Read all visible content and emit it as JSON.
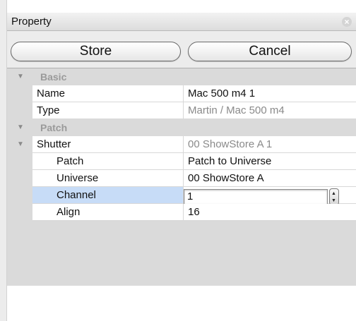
{
  "window": {
    "title": "Property"
  },
  "buttons": {
    "store_label": "Store",
    "cancel_label": "Cancel"
  },
  "sections": {
    "basic": {
      "label": "Basic",
      "rows": [
        {
          "name": "Name",
          "value": "Mac 500 m4 1"
        },
        {
          "name": "Type",
          "value": "Martin / Mac 500 m4"
        }
      ]
    },
    "patch": {
      "label": "Patch",
      "shutter": {
        "name": "Shutter",
        "value": "00 ShowStore A 1"
      },
      "rows": [
        {
          "name": "Patch",
          "value": "Patch to Universe"
        },
        {
          "name": "Universe",
          "value": "00 ShowStore A"
        },
        {
          "name": "Channel",
          "value": "1"
        },
        {
          "name": "Align",
          "value": "16"
        }
      ]
    }
  },
  "colors": {
    "selection": "#c7dcf7",
    "section_bg": "#dadada",
    "header_text": "#9a9a9a"
  }
}
